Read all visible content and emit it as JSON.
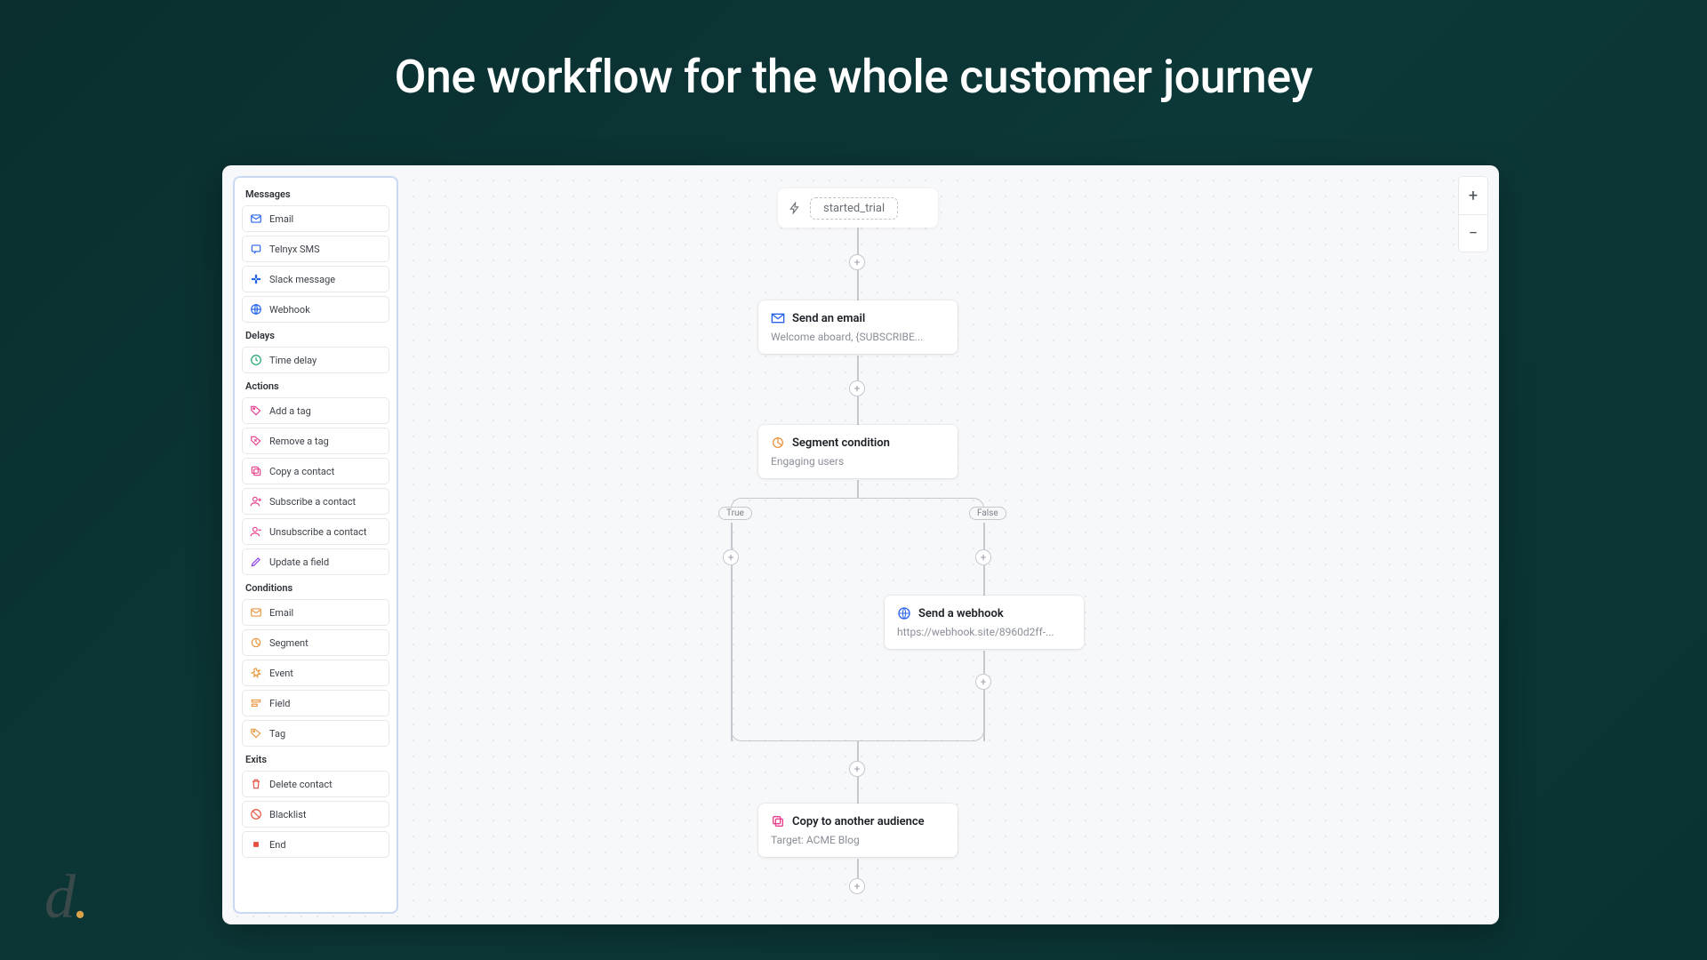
{
  "headline": "One workflow for the whole customer journey",
  "zoom": {
    "in": "+",
    "out": "−"
  },
  "sidebar": {
    "sections": [
      {
        "title": "Messages",
        "items": [
          {
            "label": "Email",
            "icon": "email",
            "color": "#2763e9"
          },
          {
            "label": "Telnyx SMS",
            "icon": "sms",
            "color": "#2763e9"
          },
          {
            "label": "Slack message",
            "icon": "slack",
            "color": "#2763e9"
          },
          {
            "label": "Webhook",
            "icon": "webhook",
            "color": "#2763e9"
          }
        ]
      },
      {
        "title": "Delays",
        "items": [
          {
            "label": "Time delay",
            "icon": "clock",
            "color": "#1aa367"
          }
        ]
      },
      {
        "title": "Actions",
        "items": [
          {
            "label": "Add a tag",
            "icon": "tag",
            "color": "#e83e8c"
          },
          {
            "label": "Remove a tag",
            "icon": "tag-x",
            "color": "#e83e8c"
          },
          {
            "label": "Copy a contact",
            "icon": "copy",
            "color": "#e83e8c"
          },
          {
            "label": "Subscribe a contact",
            "icon": "user-plus",
            "color": "#e83e8c"
          },
          {
            "label": "Unsubscribe a contact",
            "icon": "user-minus",
            "color": "#e83e8c"
          },
          {
            "label": "Update a field",
            "icon": "pencil",
            "color": "#8a3ee8"
          }
        ]
      },
      {
        "title": "Conditions",
        "items": [
          {
            "label": "Email",
            "icon": "email",
            "color": "#e8963e"
          },
          {
            "label": "Segment",
            "icon": "segment",
            "color": "#e8963e"
          },
          {
            "label": "Event",
            "icon": "burst",
            "color": "#e8963e"
          },
          {
            "label": "Field",
            "icon": "field",
            "color": "#e8963e"
          },
          {
            "label": "Tag",
            "icon": "tag",
            "color": "#e8963e"
          }
        ]
      },
      {
        "title": "Exits",
        "items": [
          {
            "label": "Delete contact",
            "icon": "trash",
            "color": "#e84e3e"
          },
          {
            "label": "Blacklist",
            "icon": "ban",
            "color": "#e84e3e"
          },
          {
            "label": "End",
            "icon": "stop",
            "color": "#e84e3e"
          }
        ]
      }
    ]
  },
  "workflow": {
    "trigger": {
      "label": "started_trial"
    },
    "nodes": {
      "email": {
        "title": "Send an email",
        "sub": "Welcome aboard, {SUBSCRIBE...",
        "color": "#2763e9"
      },
      "segment": {
        "title": "Segment condition",
        "sub": "Engaging users",
        "color": "#e8963e"
      },
      "webhook": {
        "title": "Send a webhook",
        "sub": "https://webhook.site/8960d2ff-...",
        "color": "#2763e9"
      },
      "copy": {
        "title": "Copy to another audience",
        "sub": "Target: ACME Blog",
        "color": "#e83e8c"
      }
    },
    "branches": {
      "true": "True",
      "false": "False"
    }
  }
}
